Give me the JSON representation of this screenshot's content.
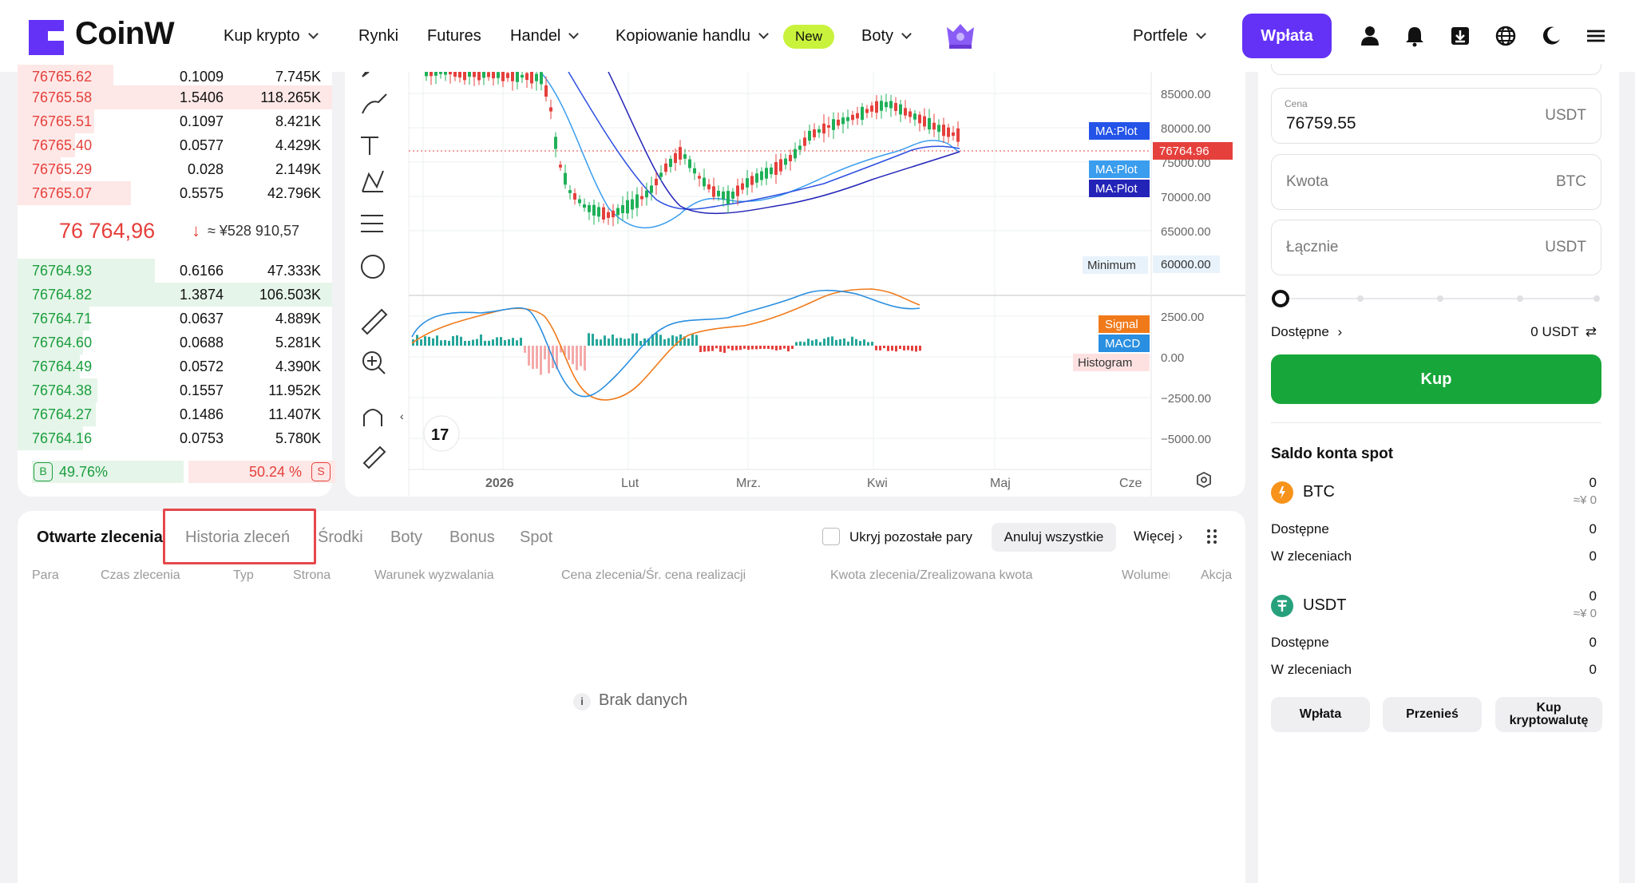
{
  "header": {
    "brand": "CoinW",
    "nav": [
      {
        "label": "Kup krypto",
        "chevron": true
      },
      {
        "label": "Rynki",
        "chevron": false
      },
      {
        "label": "Futures",
        "chevron": false
      },
      {
        "label": "Handel",
        "chevron": true
      },
      {
        "label": "Kopiowanie handlu",
        "chevron": true
      },
      {
        "label": "Boty",
        "chevron": true
      }
    ],
    "new_badge": "New",
    "wallets": "Portfele",
    "deposit": "Wpłata",
    "brand_color": "#6332f6"
  },
  "orderbook": {
    "asks": [
      {
        "price": "76765.62",
        "qty": "0.1009",
        "total": "7.745K"
      },
      {
        "price": "76765.58",
        "qty": "1.5406",
        "total": "118.265K"
      },
      {
        "price": "76765.51",
        "qty": "0.1097",
        "total": "8.421K"
      },
      {
        "price": "76765.40",
        "qty": "0.0577",
        "total": "4.429K"
      },
      {
        "price": "76765.29",
        "qty": "0.028",
        "total": "2.149K"
      },
      {
        "price": "76765.07",
        "qty": "0.5575",
        "total": "42.796K"
      }
    ],
    "last_price": "76 764,96",
    "last_cny": "≈ ¥528 910,57",
    "bids": [
      {
        "price": "76764.93",
        "qty": "0.6166",
        "total": "47.333K"
      },
      {
        "price": "76764.82",
        "qty": "1.3874",
        "total": "106.503K"
      },
      {
        "price": "76764.71",
        "qty": "0.0637",
        "total": "4.889K"
      },
      {
        "price": "76764.60",
        "qty": "0.0688",
        "total": "5.281K"
      },
      {
        "price": "76764.49",
        "qty": "0.0572",
        "total": "4.390K"
      },
      {
        "price": "76764.38",
        "qty": "0.1557",
        "total": "11.952K"
      },
      {
        "price": "76764.27",
        "qty": "0.1486",
        "total": "11.407K"
      },
      {
        "price": "76764.16",
        "qty": "0.0753",
        "total": "5.780K"
      }
    ],
    "buy_label": "B",
    "buy_ratio": "49.76%",
    "sell_ratio": "50.24 %",
    "sell_label": "S",
    "buy_color": "#1a9e3e",
    "sell_color": "#e5403c"
  },
  "chart": {
    "price_ticks": [
      "85000.00",
      "80000.00",
      "75000.00",
      "70000.00",
      "65000.00"
    ],
    "min_label": "Minimum",
    "min_value": "60000.00",
    "current_price": "76764.96",
    "ma_label": "MA:Plot",
    "macd_ticks": [
      "2500.00",
      "0.00",
      "−2500.00",
      "−5000.00"
    ],
    "signal_label": "Signal",
    "macd_label": "MACD",
    "histogram_label": "Histogram",
    "x_labels": [
      "2026",
      "Lut",
      "Mrz.",
      "Kwi",
      "Maj",
      "Cze"
    ],
    "logo_text": "17"
  },
  "trade": {
    "price_label": "Cena",
    "price_value": "76759.55",
    "price_unit": "USDT",
    "amount_placeholder": "Kwota",
    "amount_unit": "BTC",
    "total_placeholder": "Łącznie",
    "total_unit": "USDT",
    "available_label": "Dostępne",
    "available_value": "0 USDT",
    "buy_button": "Kup"
  },
  "balance": {
    "title": "Saldo konta spot",
    "coins": [
      {
        "name": "BTC",
        "value": "0",
        "cny": "≈¥ 0",
        "available_label": "Dostępne",
        "available": "0",
        "in_orders_label": "W zleceniach",
        "in_orders": "0"
      },
      {
        "name": "USDT",
        "value": "0",
        "cny": "≈¥ 0",
        "available_label": "Dostępne",
        "available": "0",
        "in_orders_label": "W zleceniach",
        "in_orders": "0"
      }
    ],
    "buttons": [
      "Wpłata",
      "Przenieś",
      "Kup kryptowalutę"
    ]
  },
  "orders": {
    "tabs": [
      "Otwarte zlecenia",
      "Historia zleceń",
      "Środki",
      "Boty",
      "Bonus",
      "Spot"
    ],
    "hide_pairs": "Ukryj pozostałe pary",
    "cancel_all": "Anuluj wszystkie",
    "more": "Więcej",
    "columns": [
      "Para",
      "Czas zlecenia",
      "Typ",
      "Strona",
      "Warunek wyzwalania",
      "Cena zlecenia/Śr. cena realizacji",
      "Kwota zlecenia/Zrealizowana kwota",
      "Wolumen",
      "Akcja"
    ],
    "empty": "Brak danych"
  }
}
